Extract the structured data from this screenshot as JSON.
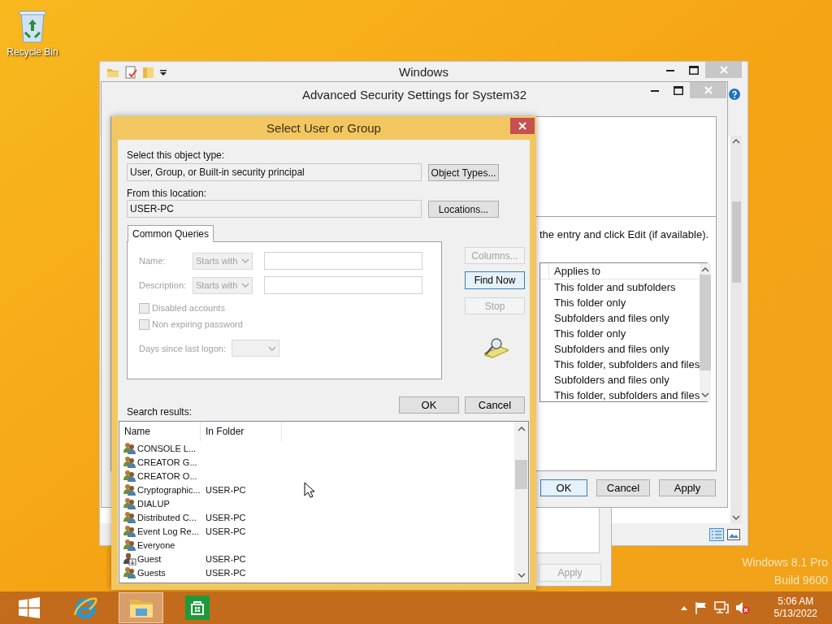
{
  "desktop": {
    "icons": [
      {
        "label": "Recycle Bin"
      }
    ],
    "watermark": {
      "edition": "Windows 8.1 Pro",
      "build": "Build 9600"
    }
  },
  "explorer_window": {
    "title": "Windows"
  },
  "properties_window": {
    "buttons": [
      {
        "label": "Apply",
        "disabled": true
      }
    ]
  },
  "advanced_security_window": {
    "title": "Advanced Security Settings for System32",
    "instruction": "the entry and click Edit (if available).",
    "permission_list": {
      "column": "Applies to",
      "rows": [
        "This folder and subfolders",
        "This folder only",
        "Subfolders and files only",
        "This folder only",
        "Subfolders and files only",
        "This folder, subfolders and files",
        "Subfolders and files only",
        "This folder, subfolders and files"
      ]
    },
    "buttons": [
      {
        "label": "OK",
        "focused": true,
        "disabled": false
      },
      {
        "label": "Cancel",
        "focused": false,
        "disabled": false
      },
      {
        "label": "Apply",
        "focused": false,
        "disabled": false
      }
    ]
  },
  "select_dialog": {
    "title": "Select User or Group",
    "object_type_label": "Select this object type:",
    "object_type": "User, Group, or Built-in security principal",
    "object_types_button": "Object Types...",
    "location_label": "From this location:",
    "location": "USER-PC",
    "locations_button": "Locations...",
    "tab": {
      "label": "Common Queries",
      "selected": true
    },
    "queries": {
      "disabled": true,
      "name_label": "Name:",
      "name_match": "Starts with",
      "description_label": "Description:",
      "description_match": "Starts with",
      "days_label": "Days since last logon:",
      "checkboxes": [
        {
          "label": "Disabled accounts",
          "checked": false
        },
        {
          "label": "Non expiring password",
          "checked": false
        }
      ]
    },
    "side_buttons": [
      {
        "label": "Columns...",
        "disabled": true,
        "focused": false
      },
      {
        "label": "Find Now",
        "disabled": false,
        "focused": true
      },
      {
        "label": "Stop",
        "disabled": true,
        "focused": false
      }
    ],
    "buttons": [
      {
        "label": "OK",
        "disabled": false,
        "focused": false
      },
      {
        "label": "Cancel",
        "disabled": false,
        "focused": false
      }
    ],
    "results_label": "Search results:",
    "results": {
      "columns": [
        "Name",
        "In Folder"
      ],
      "rows": [
        {
          "kind": "group",
          "name": "CONSOLE L..."
        },
        {
          "kind": "group",
          "name": "CREATOR G..."
        },
        {
          "kind": "group",
          "name": "CREATOR O..."
        },
        {
          "kind": "group",
          "name": "Cryptographic...",
          "folder": "USER-PC"
        },
        {
          "kind": "group",
          "name": "DIALUP"
        },
        {
          "kind": "group",
          "name": "Distributed C...",
          "folder": "USER-PC"
        },
        {
          "kind": "group",
          "name": "Event Log Re...",
          "folder": "USER-PC"
        },
        {
          "kind": "group",
          "name": "Everyone"
        },
        {
          "kind": "user",
          "name": "Guest",
          "folder": "USER-PC"
        },
        {
          "kind": "group",
          "name": "Guests",
          "folder": "USER-PC"
        }
      ]
    }
  },
  "taskbar": {
    "apps": [
      {
        "kind": "start",
        "selected": false
      },
      {
        "kind": "browser",
        "selected": false
      },
      {
        "kind": "explorer",
        "selected": true
      },
      {
        "kind": "store",
        "selected": false
      }
    ],
    "clock": {
      "time": "5:06 AM",
      "date": "5/13/2022"
    }
  }
}
